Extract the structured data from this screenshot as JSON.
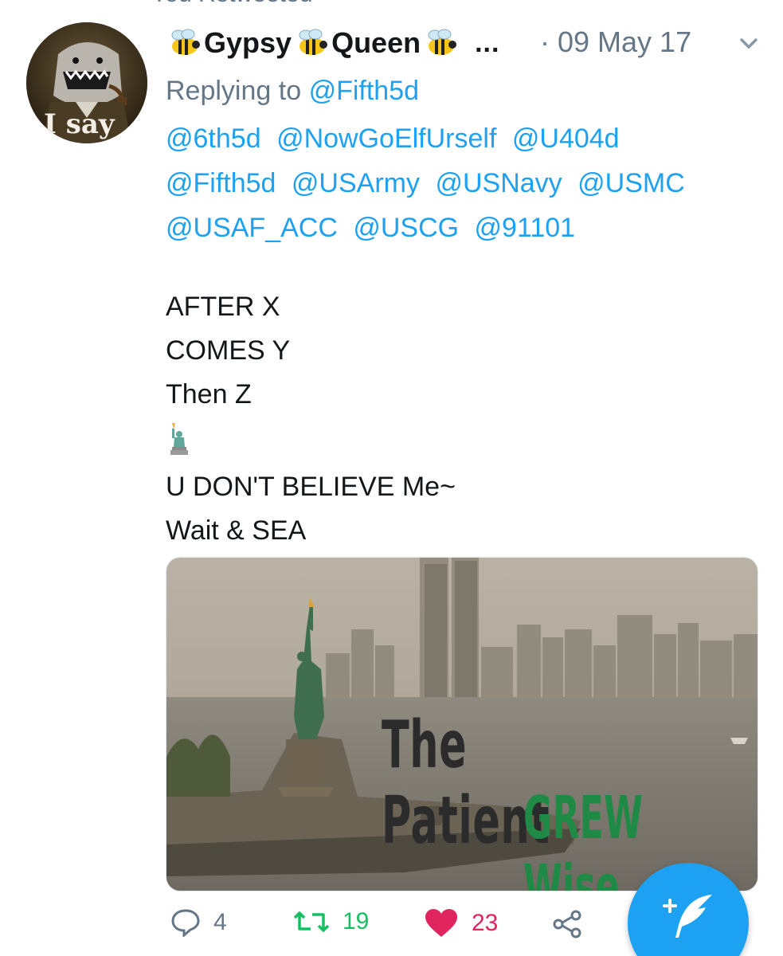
{
  "retweet_context": {
    "label": "You Retweeted"
  },
  "tweet": {
    "author": {
      "display_name_parts": [
        "Gypsy",
        "Queen"
      ],
      "name_truncation": "...",
      "avatar_text": "I say"
    },
    "timestamp": "· 09 May 17",
    "replying_prefix": "Replying to",
    "replying_handle": "@Fifth5d",
    "mentions": [
      [
        "@6th5d",
        "@NowGoElfUrself",
        "@U404d"
      ],
      [
        "@Fifth5d",
        "@USArmy",
        "@USNavy",
        "@USMC"
      ],
      [
        "@USAF_ACC",
        "@USCG",
        "@91101"
      ]
    ],
    "body": {
      "line1": "AFTER X",
      "line2": "COMES Y",
      "line3": "Then Z",
      "line5": "U DON'T BELIEVE Me~",
      "line6": "Wait & SEA"
    },
    "media": {
      "text_line1": "The Patient",
      "text_line2": "GREW Wise"
    },
    "actions": {
      "replies": "4",
      "retweets": "19",
      "likes": "23"
    }
  },
  "colors": {
    "link": "#1da1f2",
    "muted": "#657786",
    "retweet_active": "#17bf63",
    "like_active": "#e0245e",
    "fab": "#1da1f2"
  },
  "icons": [
    "retweet-icon",
    "bee-emoji-icon",
    "chevron-down-icon",
    "statue-of-liberty-emoji-icon",
    "reply-icon",
    "heart-icon",
    "share-icon",
    "compose-tweet-icon"
  ]
}
